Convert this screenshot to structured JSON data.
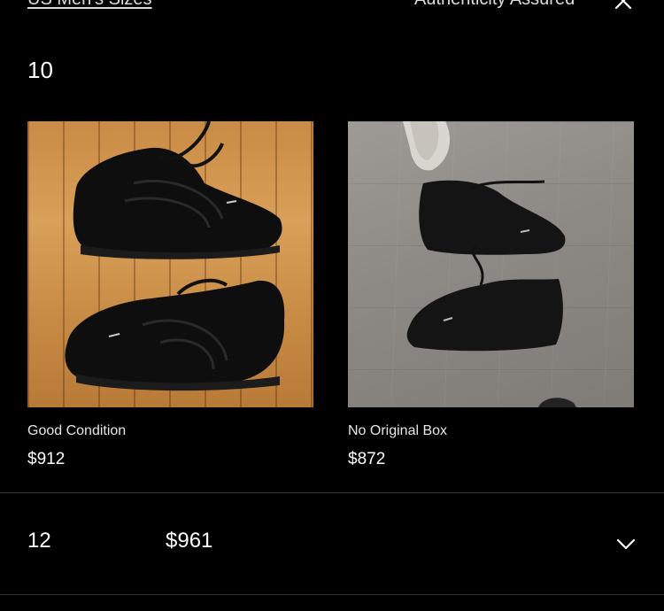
{
  "header": {
    "left_link": "US Men's Sizes",
    "right_text": "Authenticity Assured",
    "close_icon": "close-icon"
  },
  "size_section": {
    "size": "10",
    "listings": [
      {
        "condition": "Good Condition",
        "price": "$912"
      },
      {
        "condition": "No Original Box",
        "price": "$872"
      }
    ]
  },
  "collapsed_row": {
    "size": "12",
    "price": "$961",
    "icon": "chevron-down-icon"
  }
}
